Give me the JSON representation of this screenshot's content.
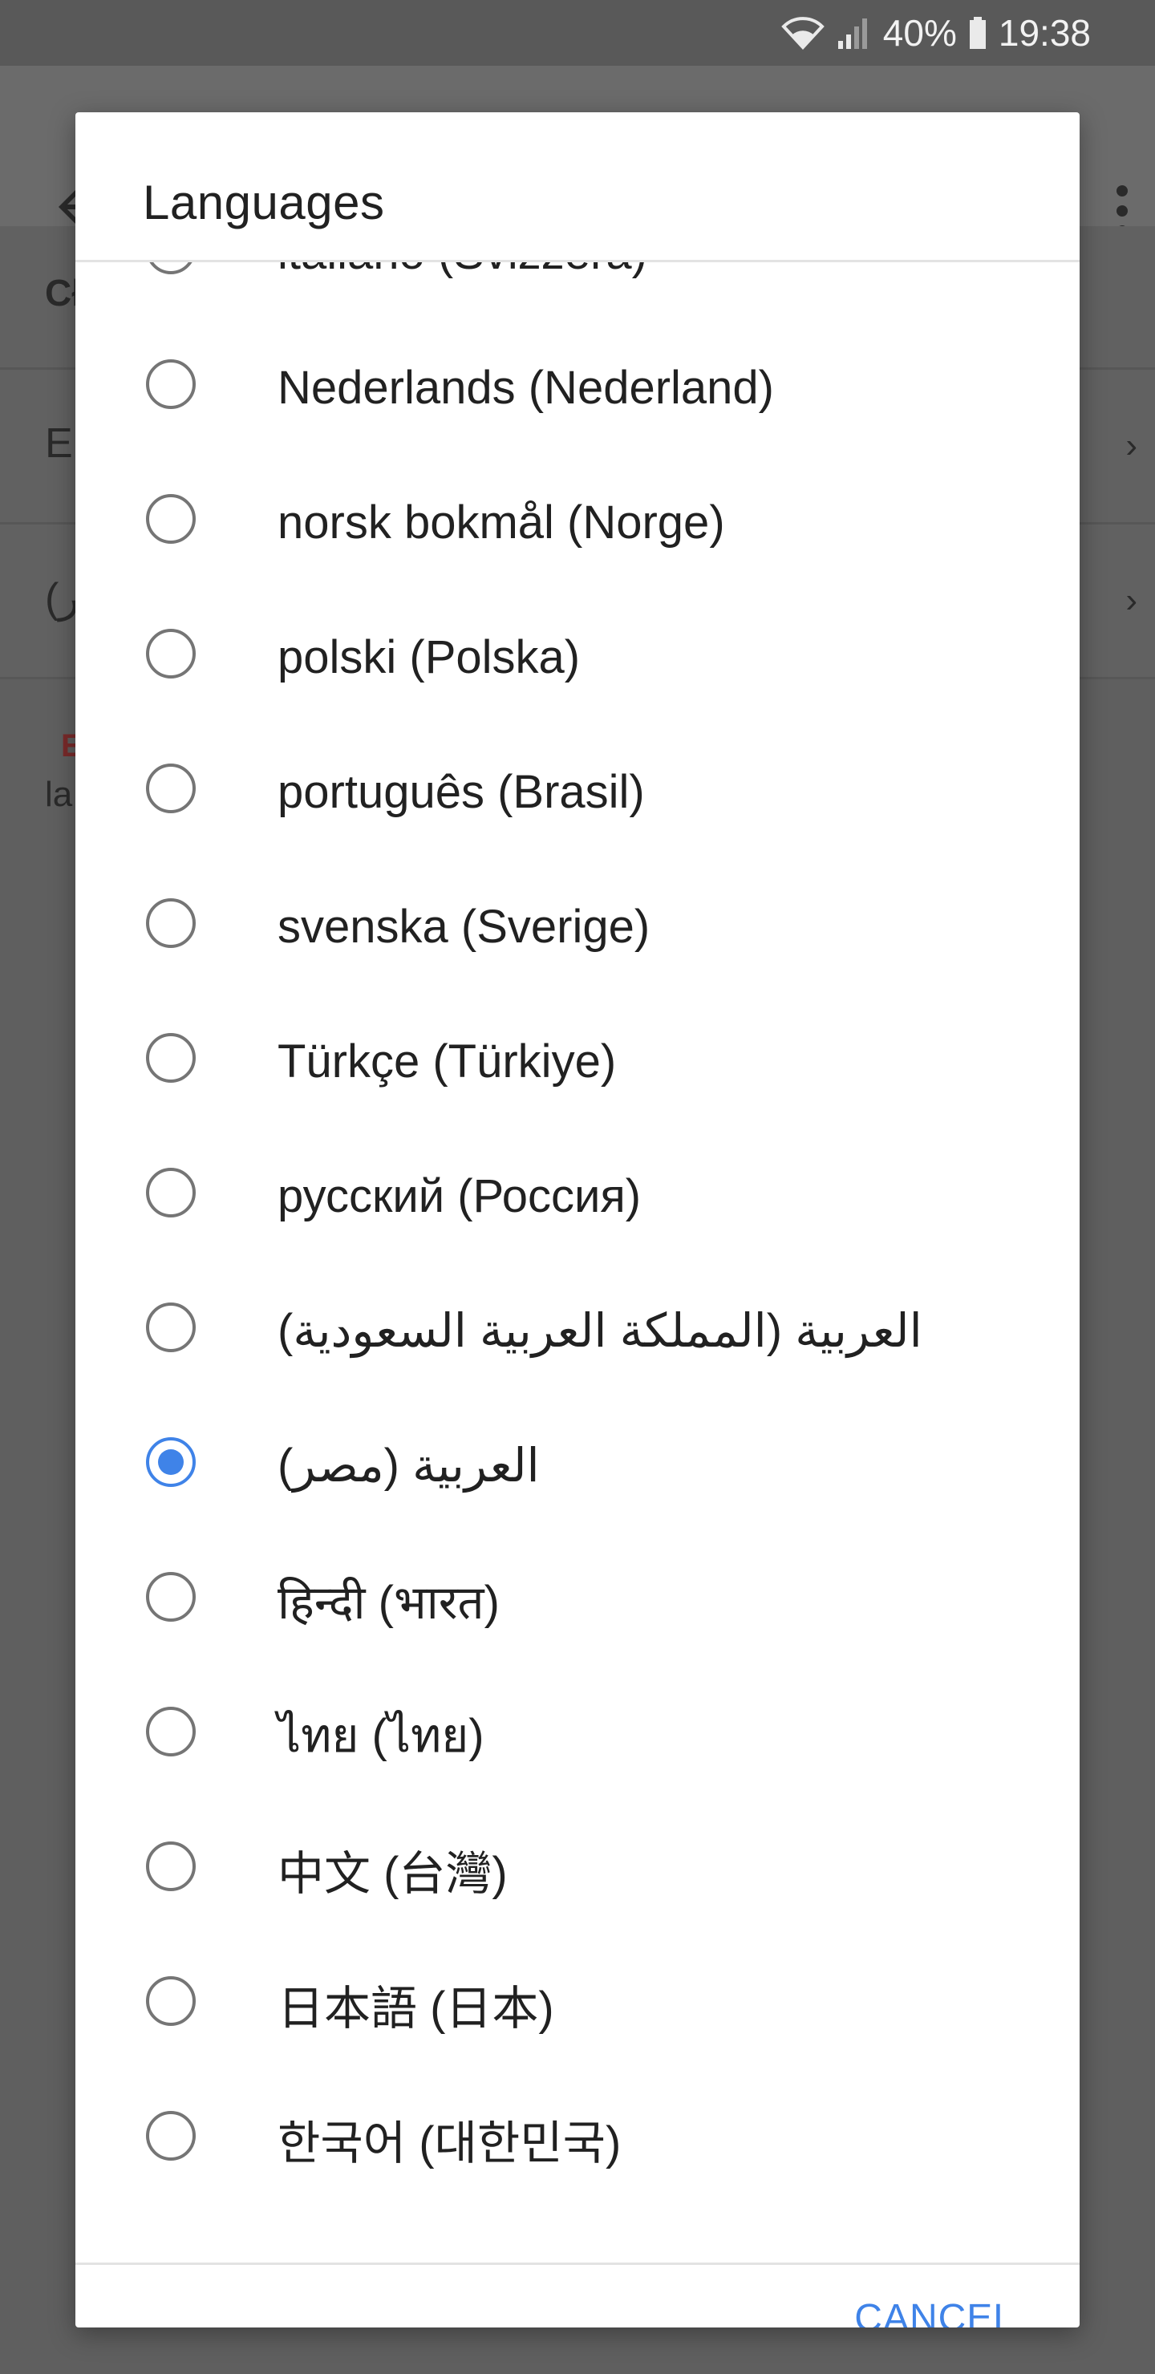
{
  "status_bar": {
    "battery_percent": "40%",
    "time": "19:38",
    "icons": [
      "wifi-icon",
      "signal-icon",
      "battery-icon"
    ]
  },
  "background": {
    "row1_text": "Cł",
    "row2_text": "Er",
    "row3_text": "(ر",
    "note_red": "E",
    "note_text": "la"
  },
  "dialog": {
    "title": "Languages",
    "cancel_label": "CANCEL",
    "accent_color": "#3f83e8",
    "options": [
      {
        "label": "italiano (Svizzera)",
        "selected": false
      },
      {
        "label": "Nederlands (Nederland)",
        "selected": false
      },
      {
        "label": "norsk bokmål (Norge)",
        "selected": false
      },
      {
        "label": "polski (Polska)",
        "selected": false
      },
      {
        "label": "português (Brasil)",
        "selected": false
      },
      {
        "label": "svenska (Sverige)",
        "selected": false
      },
      {
        "label": "Türkçe (Türkiye)",
        "selected": false
      },
      {
        "label": "русский (Россия)",
        "selected": false
      },
      {
        "label": "العربية (المملكة العربية السعودية)",
        "selected": false
      },
      {
        "label": "العربية (مصر)",
        "selected": true
      },
      {
        "label": "हिन्दी (भारत)",
        "selected": false
      },
      {
        "label": "ไทย (ไทย)",
        "selected": false
      },
      {
        "label": "中文 (台灣)",
        "selected": false
      },
      {
        "label": "日本語 (日本)",
        "selected": false
      },
      {
        "label": "한국어 (대한민국)",
        "selected": false
      }
    ]
  }
}
